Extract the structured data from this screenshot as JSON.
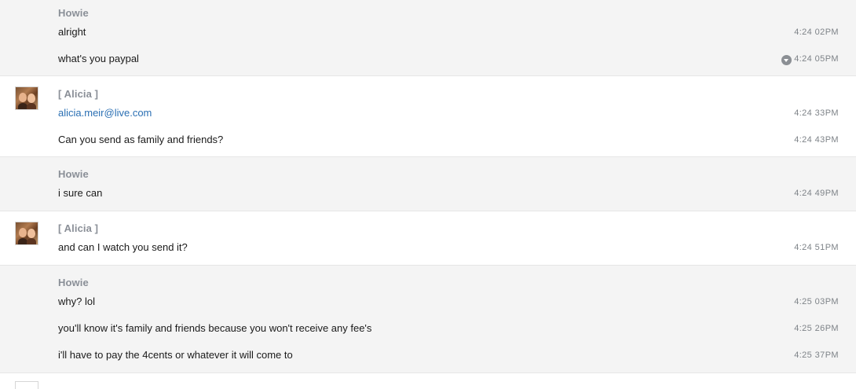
{
  "conversation": {
    "groups": [
      {
        "sender": "Howie",
        "style": "gray",
        "avatar": false,
        "messages": [
          {
            "text": "alright",
            "time": "4:24 02PM"
          },
          {
            "text": "what's you paypal",
            "time": "4:24 05PM",
            "menu_icon": "chevron-down-circle-icon"
          }
        ]
      },
      {
        "sender": "[ Alicia ]",
        "style": "white",
        "avatar": true,
        "messages": [
          {
            "text": "alicia.meir@live.com",
            "time": "4:24 33PM",
            "link": true
          },
          {
            "text": "Can you send as family and friends?",
            "time": "4:24 43PM"
          }
        ]
      },
      {
        "sender": "Howie",
        "style": "gray",
        "avatar": false,
        "messages": [
          {
            "text": "i sure can",
            "time": "4:24 49PM"
          }
        ]
      },
      {
        "sender": "[ Alicia ]",
        "style": "white",
        "avatar": true,
        "messages": [
          {
            "text": "and can I watch you send it?",
            "time": "4:24 51PM"
          }
        ]
      },
      {
        "sender": "Howie",
        "style": "gray",
        "avatar": false,
        "messages": [
          {
            "text": "why? lol",
            "time": "4:25 03PM"
          },
          {
            "text": "you'll know it's family and friends because you won't receive any fee's",
            "time": "4:25 26PM"
          },
          {
            "text": "i'll have to pay the 4cents or whatever it will come to",
            "time": "4:25 37PM"
          }
        ]
      }
    ]
  },
  "colors": {
    "gray_row": "#f4f4f4",
    "sender_text": "#8a8f97",
    "link": "#2a6fb3",
    "timestamp": "#7e8388"
  }
}
